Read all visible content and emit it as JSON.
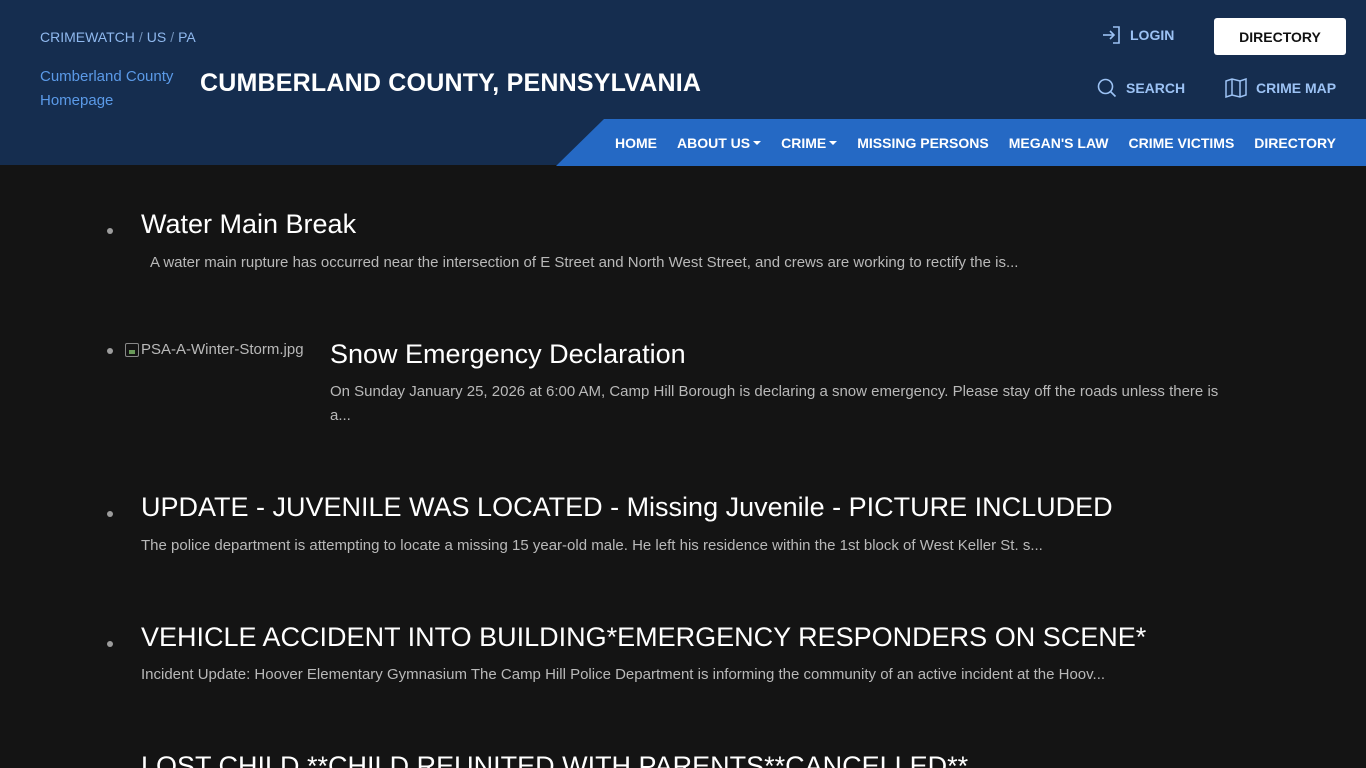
{
  "breadcrumb": [
    "CRIMEWATCH",
    "US",
    "PA"
  ],
  "logo_alt": "Cumberland County Homepage",
  "site_title": "CUMBERLAND COUNTY, PENNSYLVANIA",
  "actions": {
    "login": "LOGIN",
    "directory": "DIRECTORY",
    "search": "SEARCH",
    "crime_map": "CRIME MAP"
  },
  "nav": [
    {
      "label": "HOME",
      "dropdown": false
    },
    {
      "label": "ABOUT US",
      "dropdown": true
    },
    {
      "label": "CRIME",
      "dropdown": true
    },
    {
      "label": "MISSING PERSONS",
      "dropdown": false
    },
    {
      "label": "MEGAN'S LAW",
      "dropdown": false
    },
    {
      "label": "CRIME VICTIMS",
      "dropdown": false
    },
    {
      "label": "DIRECTORY",
      "dropdown": false
    }
  ],
  "posts": [
    {
      "title": "Water Main Break",
      "excerpt": "A water main rupture has occurred near the intersection of E Street and North West Street, and crews are working to rectify the is..."
    },
    {
      "image_alt": "PSA-A-Winter-Storm.jpg",
      "title": "Snow Emergency Declaration",
      "excerpt": "On Sunday January 25, 2026 at 6:00 AM, Camp Hill Borough is declaring a snow emergency.  Please stay off the roads unless there is a..."
    },
    {
      "title": "UPDATE - JUVENILE WAS LOCATED - Missing Juvenile - PICTURE INCLUDED",
      "excerpt": "The police department is attempting to locate a missing 15 year-old male. He left his residence within the 1st block of West Keller St. s..."
    },
    {
      "title": "VEHICLE ACCIDENT INTO BUILDING*EMERGENCY RESPONDERS ON SCENE*",
      "excerpt": "Incident Update: Hoover Elementary Gymnasium The Camp Hill Police Department is informing the community of an active incident at the Hoov..."
    },
    {
      "title": "LOST CHILD **CHILD REUNITED WITH PARENTS**CANCELLED**",
      "excerpt": ""
    }
  ]
}
